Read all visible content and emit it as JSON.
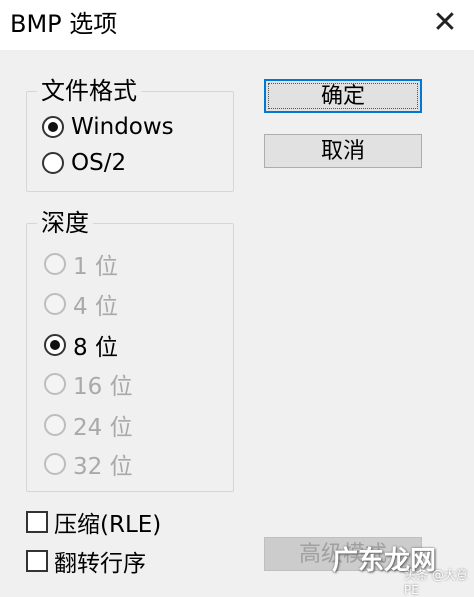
{
  "window": {
    "title": "BMP 选项",
    "close_glyph": "✕"
  },
  "file_format": {
    "label": "文件格式",
    "options": [
      {
        "label": "Windows",
        "checked": true
      },
      {
        "label": "OS/2",
        "checked": false
      }
    ]
  },
  "depth": {
    "label": "深度",
    "options": [
      {
        "label": "1 位",
        "checked": false,
        "disabled": true
      },
      {
        "label": "4 位",
        "checked": false,
        "disabled": true
      },
      {
        "label": "8 位",
        "checked": true,
        "disabled": false
      },
      {
        "label": "16 位",
        "checked": false,
        "disabled": true
      },
      {
        "label": "24 位",
        "checked": false,
        "disabled": true
      },
      {
        "label": "32 位",
        "checked": false,
        "disabled": true
      }
    ]
  },
  "checkboxes": {
    "compress_rle": {
      "label": "压缩(RLE)",
      "checked": false
    },
    "flip_row_order": {
      "label": "翻转行序",
      "checked": false
    }
  },
  "buttons": {
    "ok": "确定",
    "cancel": "取消",
    "advanced": "高级模式"
  },
  "watermark": {
    "text": "广东龙网",
    "subtext": "头条 @大意PE"
  },
  "colors": {
    "window_bg": "#f0f0f0",
    "titlebar_bg": "#ffffff",
    "default_button_border": "#0078d7",
    "disabled_text": "#a9a9a9"
  }
}
